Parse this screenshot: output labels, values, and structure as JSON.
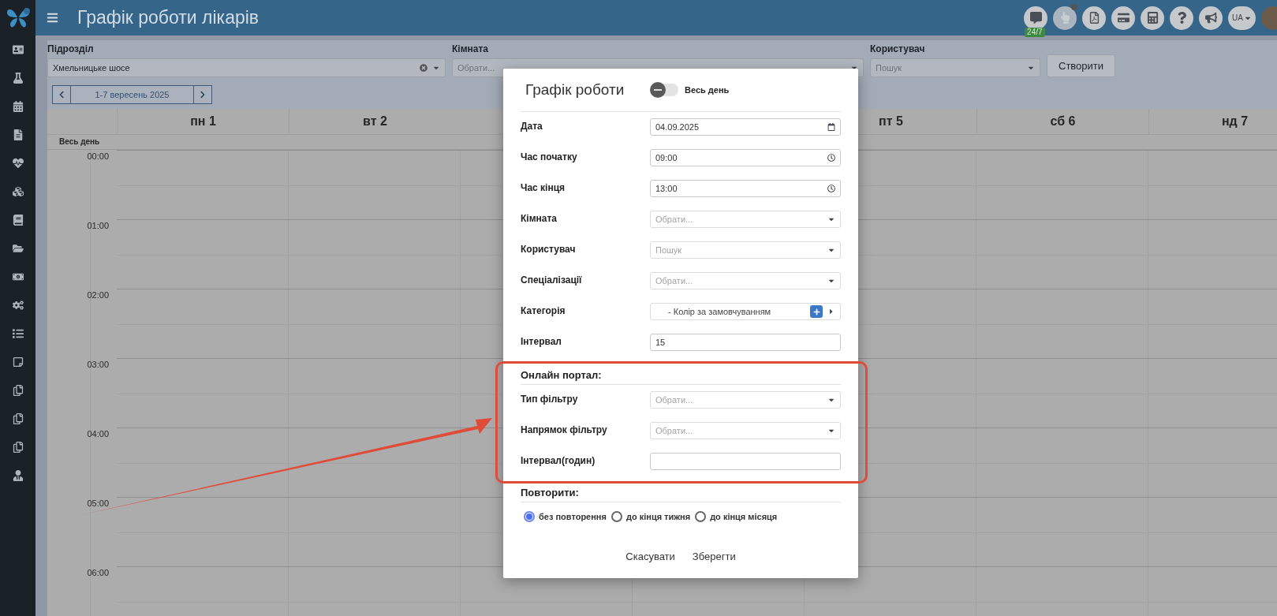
{
  "topbar": {
    "title": "Графік роботи лікарів",
    "chat_badge": "24/7",
    "language": "UA"
  },
  "filters": [
    {
      "label": "Підрозділ",
      "value": "Хмельницьке шосе",
      "clearable": true
    },
    {
      "label": "Кімната",
      "placeholder": "Обрати..."
    },
    {
      "label": "Користувач",
      "placeholder": "Пошук"
    }
  ],
  "create_button": "Створити",
  "date_nav": {
    "range": "1-7 вересень 2025"
  },
  "calendar": {
    "all_day_label": "Весь день",
    "days": [
      {
        "label": "пн 1"
      },
      {
        "label": "вт 2"
      },
      {
        "label": "пт 5"
      },
      {
        "label": "сб 6"
      },
      {
        "label": "нд 7"
      }
    ],
    "hours": [
      "00:00",
      "01:00",
      "02:00",
      "03:00",
      "04:00",
      "05:00",
      "06:00"
    ]
  },
  "modal": {
    "title": "Графік роботи",
    "all_day": {
      "label": "Весь день",
      "on": false
    },
    "fields": [
      {
        "kind": "date",
        "label": "Дата",
        "value": "04.09.2025"
      },
      {
        "kind": "time",
        "label": "Час початку",
        "value": "09:00"
      },
      {
        "kind": "time",
        "label": "Час кінця",
        "value": "13:00"
      },
      {
        "kind": "select",
        "label": "Кімната",
        "placeholder": "Обрати..."
      },
      {
        "kind": "select",
        "label": "Користувач",
        "placeholder": "Пошук"
      },
      {
        "kind": "select",
        "label": "Спеціалізації",
        "placeholder": "Обрати..."
      },
      {
        "kind": "category",
        "label": "Категорія",
        "value": "- Колір за замовчуванням"
      },
      {
        "kind": "text",
        "label": "Інтервал",
        "value": "15"
      }
    ],
    "online_portal": {
      "title": "Онлайн портал:",
      "fields": [
        {
          "kind": "select",
          "label": "Тип фільтру",
          "placeholder": "Обрати..."
        },
        {
          "kind": "select",
          "label": "Напрямок фільтру",
          "placeholder": "Обрати..."
        },
        {
          "kind": "text",
          "label": "Інтервал(годин)"
        }
      ]
    },
    "repeat": {
      "title": "Повторити:",
      "options": [
        {
          "label": "без повторення",
          "selected": true
        },
        {
          "label": "до кінця тижня",
          "selected": false
        },
        {
          "label": "до кінця місяця",
          "selected": false
        }
      ]
    },
    "buttons": [
      "Скасувати",
      "Зберегти"
    ]
  }
}
